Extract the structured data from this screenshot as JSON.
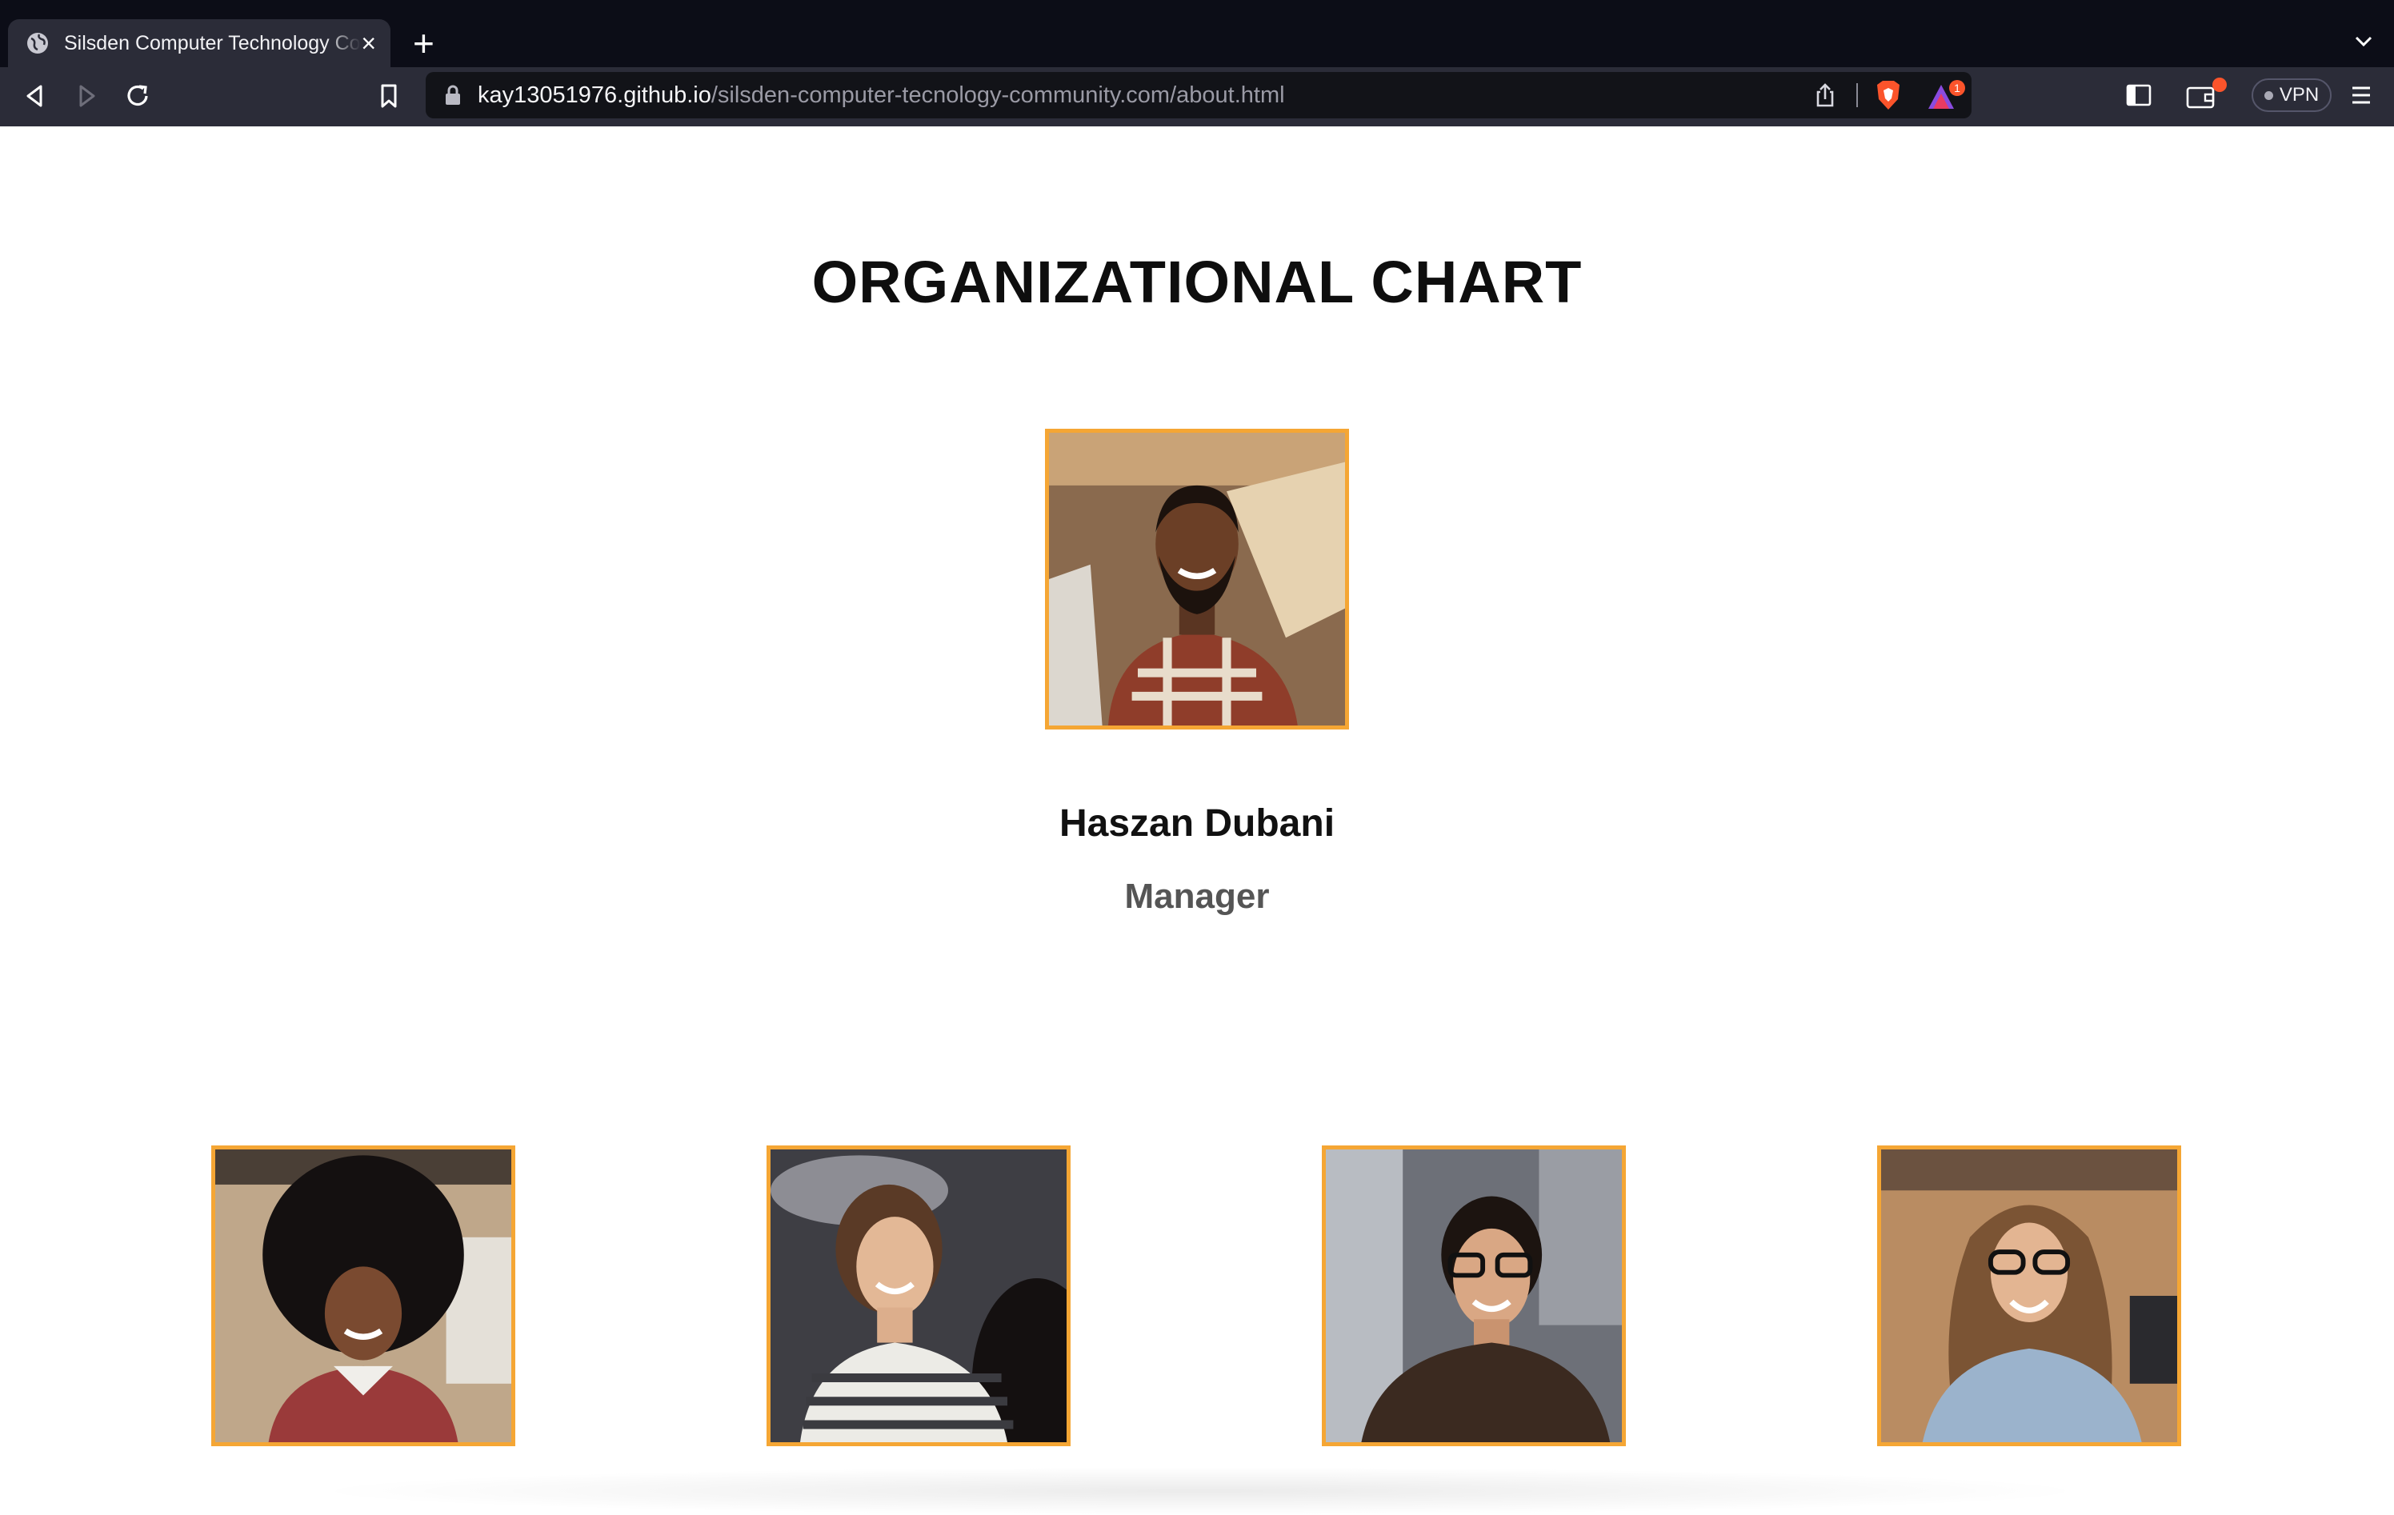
{
  "browser": {
    "tab_title": "Silsden Computer Technology Community",
    "url_host": "kay13051976.github.io",
    "url_path": "/silsden-computer-tecnology-community.com/about.html",
    "vpn_label": "VPN",
    "rewards_badge": "1",
    "accent_color": "#fb542b"
  },
  "page": {
    "title": "ORGANIZATIONAL CHART",
    "frame_color": "#f5a634"
  },
  "manager": {
    "name": "Haszan Dubani",
    "role": "Manager"
  },
  "team": [
    {
      "photo": "woman-curly-hair-red-sweater"
    },
    {
      "photo": "woman-striped-top"
    },
    {
      "photo": "man-glasses-dark-shirt"
    },
    {
      "photo": "woman-glasses-denim-shirt"
    }
  ]
}
